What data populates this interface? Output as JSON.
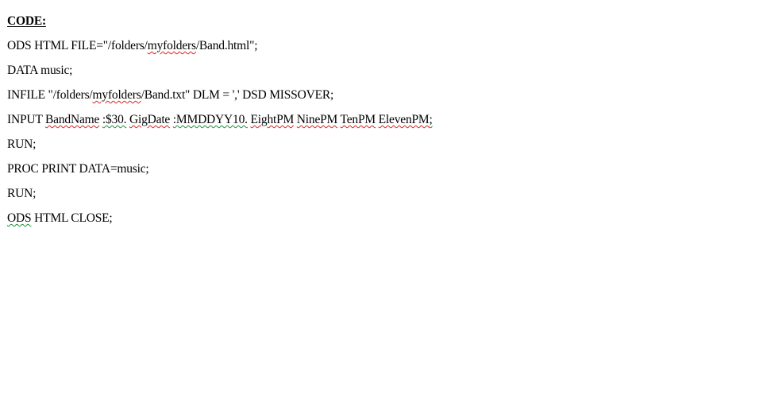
{
  "document": {
    "heading": "CODE:",
    "lines": [
      [
        {
          "text": "ODS HTML FILE=\"/folders/"
        },
        {
          "text": "myfolders",
          "mark": "red"
        },
        {
          "text": "/Band.html\";"
        }
      ],
      [
        {
          "text": "DATA music;"
        }
      ],
      [
        {
          "text": "INFILE \"/folders/"
        },
        {
          "text": "myfolders",
          "mark": "red"
        },
        {
          "text": "/Band.txt\" DLM = ',' DSD MISSOVER;"
        }
      ],
      [
        {
          "text": "INPUT "
        },
        {
          "text": "BandName",
          "mark": "red"
        },
        {
          "text": " "
        },
        {
          "text": ":$30.",
          "mark": "green"
        },
        {
          "text": " "
        },
        {
          "text": "GigDate",
          "mark": "red"
        },
        {
          "text": " "
        },
        {
          "text": ":MMDDYY10.",
          "mark": "green"
        },
        {
          "text": " "
        },
        {
          "text": "EightPM",
          "mark": "red"
        },
        {
          "text": " "
        },
        {
          "text": "NinePM",
          "mark": "red"
        },
        {
          "text": " "
        },
        {
          "text": "TenPM",
          "mark": "red"
        },
        {
          "text": " "
        },
        {
          "text": "ElevenPM",
          "mark": "red"
        },
        {
          "text": ";",
          "mark": "green"
        }
      ],
      [
        {
          "text": "RUN;"
        }
      ],
      [
        {
          "text": "PROC PRINT DATA=music;"
        }
      ],
      [
        {
          "text": "RUN;"
        }
      ],
      [
        {
          "text": "ODS",
          "mark": "green"
        },
        {
          "text": " HTML CLOSE;"
        }
      ]
    ],
    "colors": {
      "spelling_underline": "#e02020",
      "grammar_underline": "#1a8f3a"
    }
  }
}
